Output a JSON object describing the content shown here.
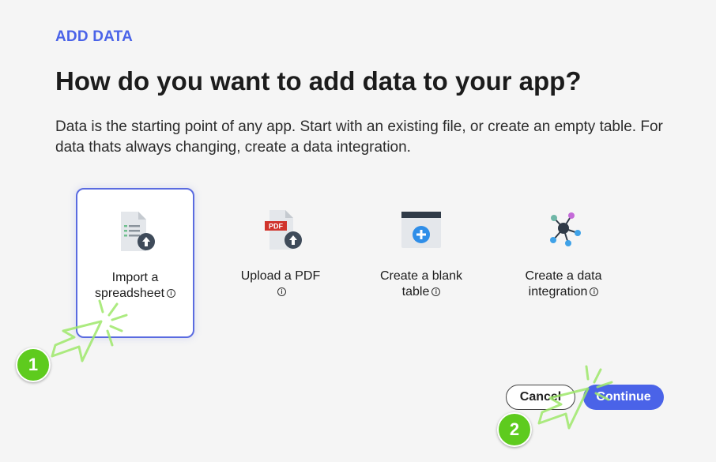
{
  "header": {
    "eyebrow": "ADD DATA",
    "title": "How do you want to add data to your app?",
    "description": "Data is the starting point of any app. Start with an existing file, or create an empty table. For data thats always changing, create a data integration."
  },
  "options": [
    {
      "line1": "Import a",
      "line2": "spreadsheet",
      "icon": "spreadsheet-upload-icon",
      "selected": true
    },
    {
      "line1": "Upload a PDF",
      "line2": "",
      "icon": "pdf-upload-icon",
      "selected": false
    },
    {
      "line1": "Create a blank",
      "line2": "table",
      "icon": "blank-table-add-icon",
      "selected": false
    },
    {
      "line1": "Create a data",
      "line2": "integration",
      "icon": "integration-network-icon",
      "selected": false
    }
  ],
  "info_glyph": "i",
  "pdf_badge": "PDF",
  "footer": {
    "cancel_label": "Cancel",
    "continue_label": "Continue"
  },
  "steps": {
    "one": "1",
    "two": "2"
  },
  "colors": {
    "accent": "#4a63e8",
    "step_badge": "#5ecb1e",
    "background": "#f5f5f5"
  }
}
